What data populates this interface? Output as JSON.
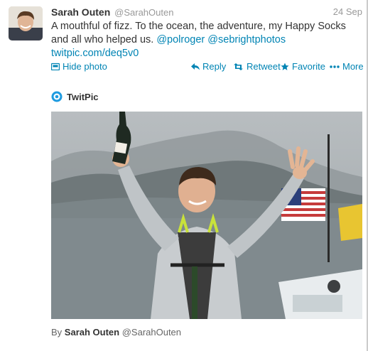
{
  "tweet": {
    "author_name": "Sarah Outen",
    "author_handle": "@SarahOuten",
    "timestamp": "24 Sep",
    "text_line1": "A mouthful of fizz. To the ocean, the adventure, my Happy Socks",
    "text_line2_prefix": "and all who helped us. ",
    "mention1": "@polroger",
    "mention2": "@sebrightphotos",
    "link": "twitpic.com/deq5v0"
  },
  "actions": {
    "hide_photo": "Hide photo",
    "reply": "Reply",
    "retweet": "Retweet",
    "favorite": "Favorite",
    "more": "More"
  },
  "media": {
    "provider": "TwitPic",
    "byline_prefix": "By",
    "byline_name": "Sarah Outen",
    "byline_handle": "@SarahOuten"
  },
  "colors": {
    "link": "#0084b4",
    "text": "#333333",
    "muted": "#999999"
  },
  "icons": [
    "photo-icon",
    "reply-icon",
    "retweet-icon",
    "favorite-icon",
    "more-icon",
    "twitpic-logo-icon"
  ]
}
